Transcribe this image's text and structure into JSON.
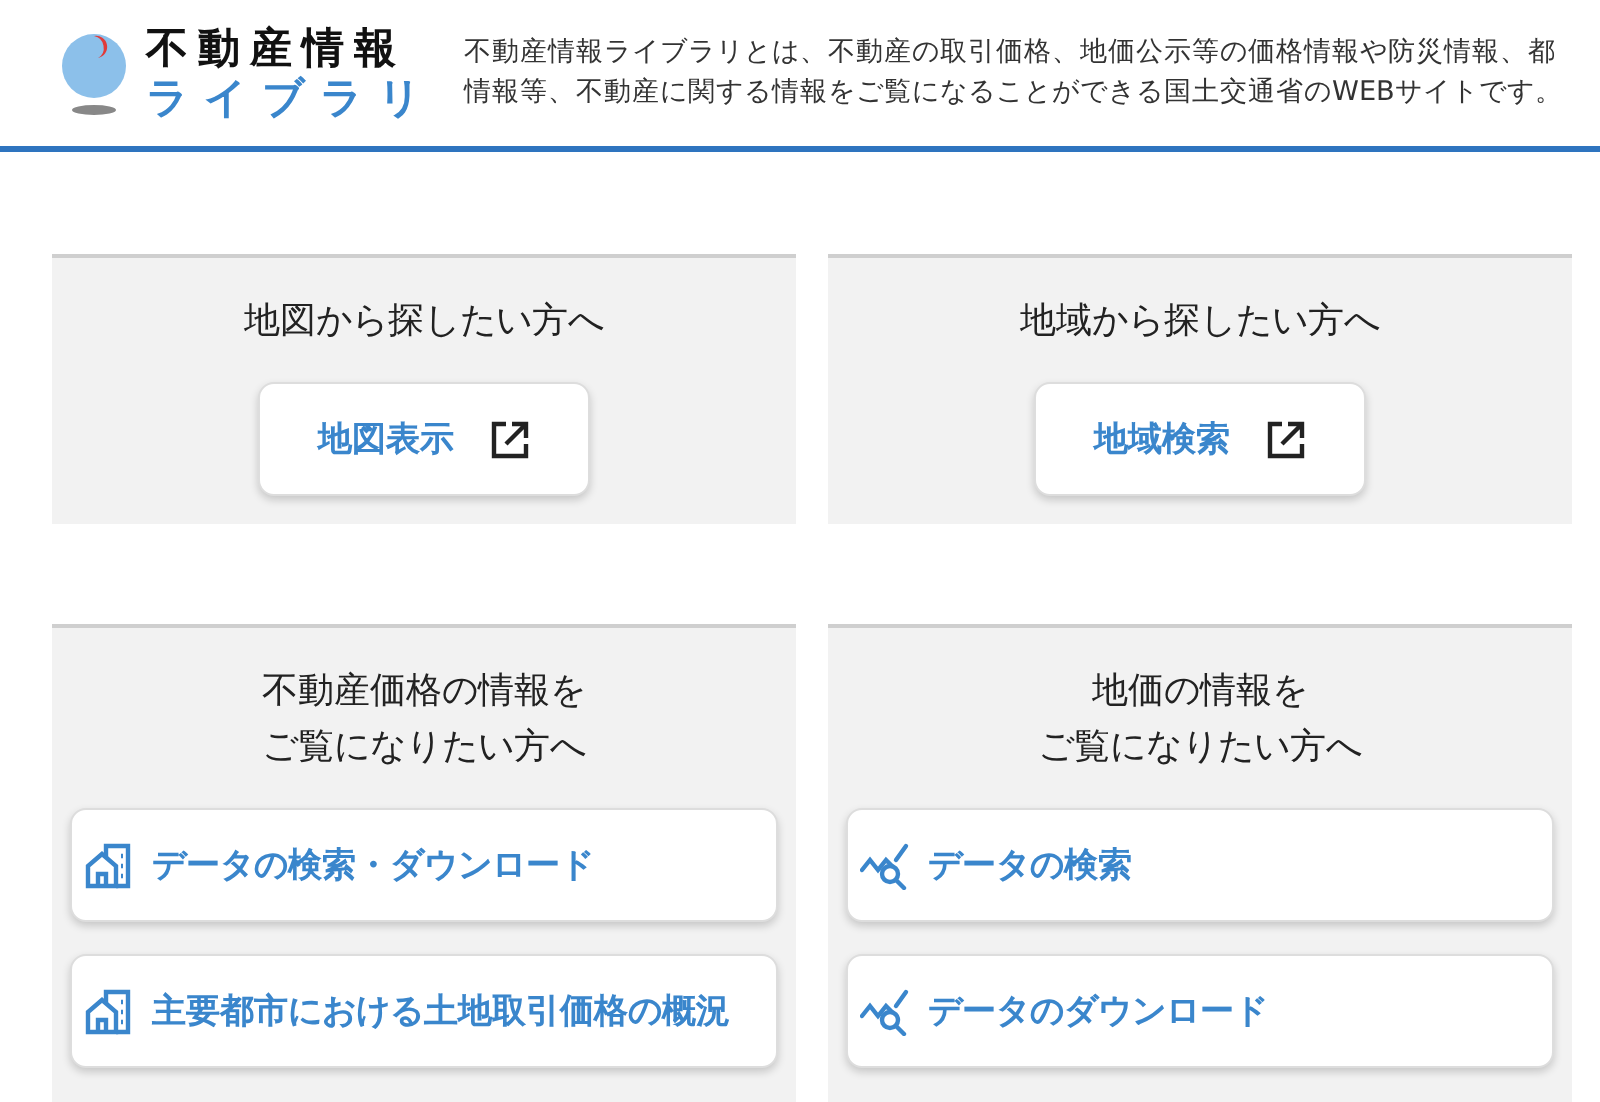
{
  "header": {
    "logo": {
      "title": "不動産情報",
      "subtitle": "ライブラリ"
    },
    "description": [
      "不動産情報ライブラリとは、不動産の取引価格、地価公示等の価格情報や防災情報、都",
      "情報等、不動産に関する情報をご覧になることができる国土交通省のWEBサイトです。"
    ]
  },
  "sections": [
    {
      "title": [
        "地図から探したい方へ"
      ],
      "links": [
        {
          "label": "地図表示",
          "kind": "external"
        }
      ]
    },
    {
      "title": [
        "地域から探したい方へ"
      ],
      "links": [
        {
          "label": "地域検索",
          "kind": "external"
        }
      ]
    },
    {
      "title": [
        "不動産価格の情報を",
        "ご覧になりたい方へ"
      ],
      "links": [
        {
          "label": "データの検索・ダウンロード",
          "kind": "building"
        },
        {
          "label": "主要都市における土地取引価格の概況",
          "kind": "building"
        }
      ]
    },
    {
      "title": [
        "地価の情報を",
        "ご覧になりたい方へ"
      ],
      "links": [
        {
          "label": "データの検索",
          "kind": "chart"
        },
        {
          "label": "データのダウンロード",
          "kind": "chart"
        }
      ]
    }
  ]
}
